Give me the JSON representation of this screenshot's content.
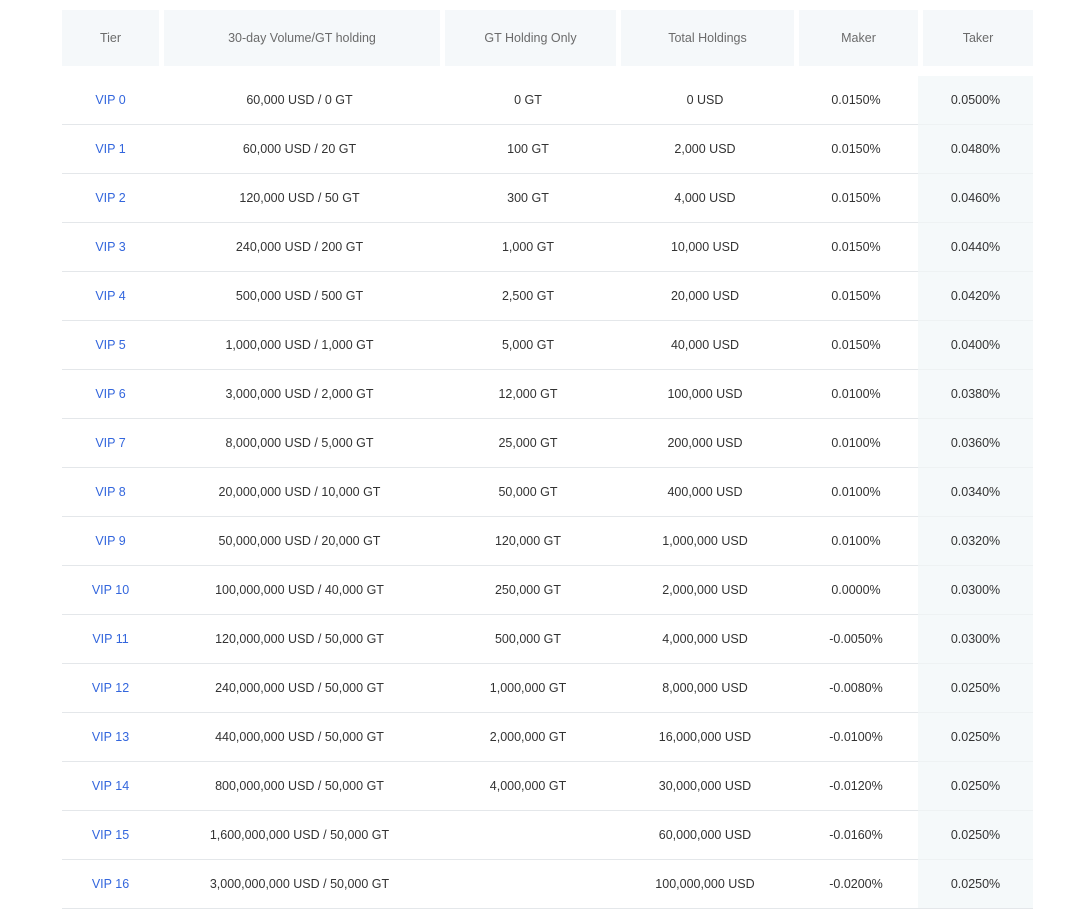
{
  "table": {
    "columns": [
      {
        "key": "tier",
        "label": "Tier"
      },
      {
        "key": "volume",
        "label": "30-day Volume/GT holding"
      },
      {
        "key": "gtonly",
        "label": "GT Holding Only"
      },
      {
        "key": "total",
        "label": "Total Holdings"
      },
      {
        "key": "maker",
        "label": "Maker"
      },
      {
        "key": "taker",
        "label": "Taker"
      }
    ],
    "rows": [
      {
        "tier": "VIP 0",
        "volume": "60,000 USD / 0 GT",
        "gtonly": "0 GT",
        "total": "0 USD",
        "maker": "0.0150%",
        "taker": "0.0500%"
      },
      {
        "tier": "VIP 1",
        "volume": "60,000 USD / 20 GT",
        "gtonly": "100 GT",
        "total": "2,000 USD",
        "maker": "0.0150%",
        "taker": "0.0480%"
      },
      {
        "tier": "VIP 2",
        "volume": "120,000 USD / 50 GT",
        "gtonly": "300 GT",
        "total": "4,000 USD",
        "maker": "0.0150%",
        "taker": "0.0460%"
      },
      {
        "tier": "VIP 3",
        "volume": "240,000 USD / 200 GT",
        "gtonly": "1,000 GT",
        "total": "10,000 USD",
        "maker": "0.0150%",
        "taker": "0.0440%"
      },
      {
        "tier": "VIP 4",
        "volume": "500,000 USD / 500 GT",
        "gtonly": "2,500 GT",
        "total": "20,000 USD",
        "maker": "0.0150%",
        "taker": "0.0420%"
      },
      {
        "tier": "VIP 5",
        "volume": "1,000,000 USD / 1,000 GT",
        "gtonly": "5,000 GT",
        "total": "40,000 USD",
        "maker": "0.0150%",
        "taker": "0.0400%"
      },
      {
        "tier": "VIP 6",
        "volume": "3,000,000 USD / 2,000 GT",
        "gtonly": "12,000 GT",
        "total": "100,000 USD",
        "maker": "0.0100%",
        "taker": "0.0380%"
      },
      {
        "tier": "VIP 7",
        "volume": "8,000,000 USD / 5,000 GT",
        "gtonly": "25,000 GT",
        "total": "200,000 USD",
        "maker": "0.0100%",
        "taker": "0.0360%"
      },
      {
        "tier": "VIP 8",
        "volume": "20,000,000 USD / 10,000 GT",
        "gtonly": "50,000 GT",
        "total": "400,000 USD",
        "maker": "0.0100%",
        "taker": "0.0340%"
      },
      {
        "tier": "VIP 9",
        "volume": "50,000,000 USD / 20,000 GT",
        "gtonly": "120,000 GT",
        "total": "1,000,000 USD",
        "maker": "0.0100%",
        "taker": "0.0320%"
      },
      {
        "tier": "VIP 10",
        "volume": "100,000,000 USD / 40,000 GT",
        "gtonly": "250,000 GT",
        "total": "2,000,000 USD",
        "maker": "0.0000%",
        "taker": "0.0300%"
      },
      {
        "tier": "VIP 11",
        "volume": "120,000,000 USD / 50,000 GT",
        "gtonly": "500,000 GT",
        "total": "4,000,000 USD",
        "maker": "-0.0050%",
        "taker": "0.0300%"
      },
      {
        "tier": "VIP 12",
        "volume": "240,000,000 USD / 50,000 GT",
        "gtonly": "1,000,000 GT",
        "total": "8,000,000 USD",
        "maker": "-0.0080%",
        "taker": "0.0250%"
      },
      {
        "tier": "VIP 13",
        "volume": "440,000,000 USD / 50,000 GT",
        "gtonly": "2,000,000 GT",
        "total": "16,000,000 USD",
        "maker": "-0.0100%",
        "taker": "0.0250%"
      },
      {
        "tier": "VIP 14",
        "volume": "800,000,000 USD / 50,000 GT",
        "gtonly": "4,000,000 GT",
        "total": "30,000,000 USD",
        "maker": "-0.0120%",
        "taker": "0.0250%"
      },
      {
        "tier": "VIP 15",
        "volume": "1,600,000,000 USD / 50,000 GT",
        "gtonly": "",
        "total": "60,000,000 USD",
        "maker": "-0.0160%",
        "taker": "0.0250%"
      },
      {
        "tier": "VIP 16",
        "volume": "3,000,000,000 USD / 50,000 GT",
        "gtonly": "",
        "total": "100,000,000 USD",
        "maker": "-0.0200%",
        "taker": "0.0250%"
      }
    ]
  },
  "colors": {
    "header_bg": "#f5f8fa",
    "header_text": "#6b6b6b",
    "body_text": "#333333",
    "link": "#3366dd",
    "taker_col_bg": "#f5f9fa",
    "row_divider": "#e4e7ea",
    "page_bg": "#ffffff"
  }
}
